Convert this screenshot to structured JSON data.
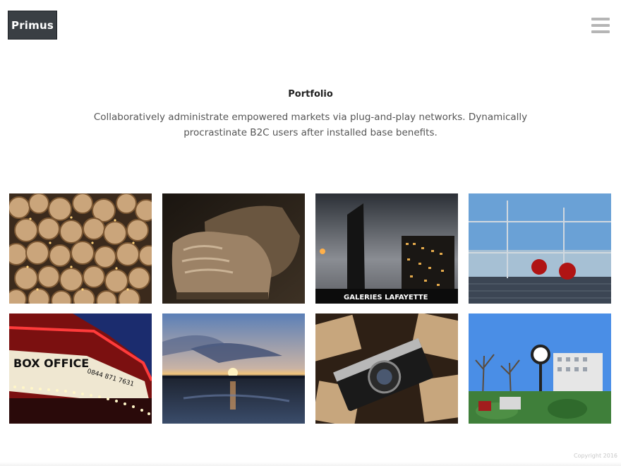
{
  "header": {
    "logo_text": "Primus",
    "menu_icon": "hamburger-icon"
  },
  "hero": {
    "title": "Portfolio",
    "description": "Collaboratively administrate empowered markets via plug-and-play networks. Dynamically procrastinate B2C users after installed base benefits."
  },
  "gallery": {
    "tiles": [
      {
        "subject": "stacked-logs"
      },
      {
        "subject": "leather-boots"
      },
      {
        "subject": "city-towers",
        "sign_text": "GALERIES LAFAYETTE"
      },
      {
        "subject": "glass-terrace"
      },
      {
        "subject": "theater-marquee",
        "sign_text": "BOX OFFICE",
        "phone_text": "0844 871 7631"
      },
      {
        "subject": "lake-sunset"
      },
      {
        "subject": "vintage-camera"
      },
      {
        "subject": "park-clock"
      }
    ]
  },
  "footer": {
    "copyright": "Copyright 2016"
  },
  "colors": {
    "logo_bg": "#3a3f44",
    "menu_icon": "#b5b5b5"
  }
}
